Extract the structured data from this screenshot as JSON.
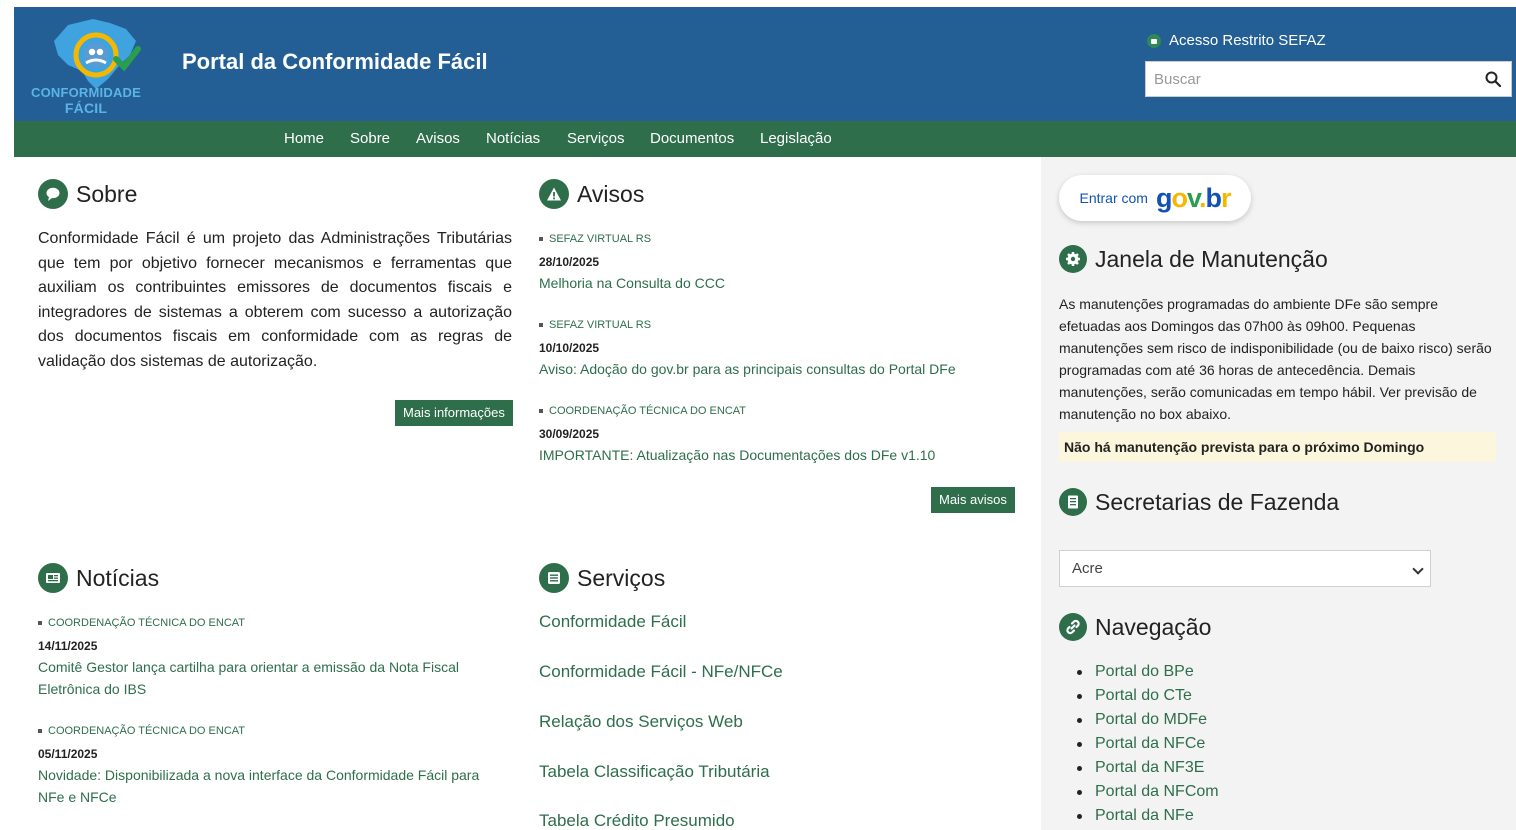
{
  "header": {
    "logo_line1": "CONFORMIDADE",
    "logo_line2": "FÁCIL",
    "site_title": "Portal da Conformidade Fácil",
    "restricted_access": "Acesso Restrito SEFAZ",
    "search_placeholder": "Buscar"
  },
  "nav": [
    "Home",
    "Sobre",
    "Avisos",
    "Notícias",
    "Serviços",
    "Documentos",
    "Legislação"
  ],
  "sobre": {
    "title": "Sobre",
    "text": "Conformidade Fácil é um projeto das Administrações Tributárias que tem por objetivo fornecer mecanismos e ferramentas que auxiliam os contribuintes emissores de documentos fiscais e integradores de sistemas a obterem com sucesso a autorização dos documentos fiscais em conformidade com as regras de validação dos sistemas de autorização.",
    "button": "Mais informações"
  },
  "avisos": {
    "title": "Avisos",
    "items": [
      {
        "category": "SEFAZ VIRTUAL RS",
        "date": "28/10/2025",
        "title": "Melhoria na Consulta do CCC"
      },
      {
        "category": "SEFAZ VIRTUAL RS",
        "date": "10/10/2025",
        "title": "Aviso: Adoção do gov.br para as principais consultas do Portal DFe"
      },
      {
        "category": "Coordenação Técnica do ENCAT",
        "date": "30/09/2025",
        "title": "IMPORTANTE: Atualização nas Documentações dos DFe v1.10"
      }
    ],
    "button": "Mais avisos"
  },
  "noticias": {
    "title": "Notícias",
    "items": [
      {
        "category": "Coordenação Técnica do ENCAT",
        "date": "14/11/2025",
        "title": "Comitê Gestor lança cartilha para orientar a emissão da Nota Fiscal Eletrônica do IBS"
      },
      {
        "category": "Coordenação Técnica do ENCAT",
        "date": "05/11/2025",
        "title": "Novidade: Disponibilizada a nova interface da Conformidade Fácil para NFe e NFCe"
      }
    ]
  },
  "servicos": {
    "title": "Serviços",
    "items": [
      "Conformidade Fácil",
      "Conformidade Fácil - NFe/NFCe",
      "Relação dos Serviços Web",
      "Tabela Classificação Tributária",
      "Tabela Crédito Presumido"
    ]
  },
  "sidebar": {
    "login_label": "Entrar com",
    "login_brand": "gov.br",
    "maintenance_title": "Janela de Manutenção",
    "maintenance_text": "As manutenções programadas do ambiente DFe são sempre efetuadas aos Domingos das 07h00 às 09h00. Pequenas manutenções sem risco de indisponibilidade (ou de baixo risco) serão programadas com até 36 horas de antecedência. Demais manutenções, serão comunicadas em tempo hábil. Ver previsão de manutenção no box abaixo.",
    "maintenance_alert": "Não há manutenção prevista para o próximo Domingo",
    "secretarias_title": "Secretarias de Fazenda",
    "secretarias_selected": "Acre",
    "navegacao_title": "Navegação",
    "navegacao_items": [
      "Portal do BPe",
      "Portal do CTe",
      "Portal do MDFe",
      "Portal da NFCe",
      "Portal da NF3E",
      "Portal da NFCom",
      "Portal da NFe"
    ]
  },
  "colors": {
    "header_blue": "#235f94",
    "nav_green": "#2e6e4b",
    "link_green": "#2e6e4b",
    "sidebar_bg": "#f3f3f3",
    "alert_bg": "#fbf6dc"
  }
}
